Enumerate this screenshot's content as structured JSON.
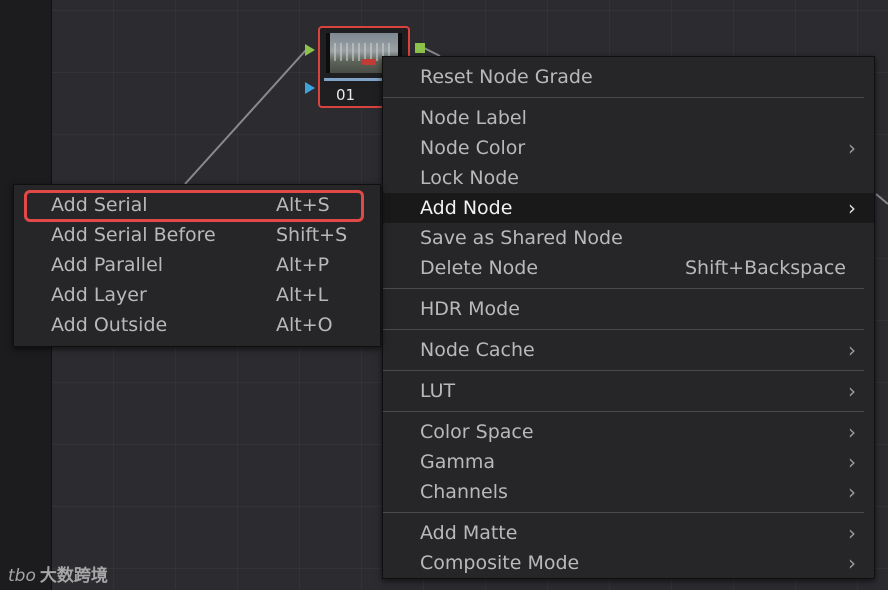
{
  "node": {
    "label": "01"
  },
  "context_menu": {
    "sections": [
      [
        {
          "label": "Reset Node Grade"
        }
      ],
      [
        {
          "label": "Node Label"
        },
        {
          "label": "Node Color",
          "submenu": true
        },
        {
          "label": "Lock Node"
        },
        {
          "label": "Add Node",
          "submenu": true,
          "active": true
        },
        {
          "label": "Save as Shared Node"
        },
        {
          "label": "Delete Node",
          "shortcut": "Shift+Backspace"
        }
      ],
      [
        {
          "label": "HDR Mode"
        }
      ],
      [
        {
          "label": "Node Cache",
          "submenu": true
        }
      ],
      [
        {
          "label": "LUT",
          "submenu": true
        }
      ],
      [
        {
          "label": "Color Space",
          "submenu": true
        },
        {
          "label": "Gamma",
          "submenu": true
        },
        {
          "label": "Channels",
          "submenu": true
        }
      ],
      [
        {
          "label": "Add Matte",
          "submenu": true
        },
        {
          "label": "Composite Mode",
          "submenu": true
        }
      ]
    ]
  },
  "add_node_submenu": {
    "items": [
      {
        "label": "Add Serial",
        "shortcut": "Alt+S",
        "highlighted": true
      },
      {
        "label": "Add Serial Before",
        "shortcut": "Shift+S"
      },
      {
        "label": "Add Parallel",
        "shortcut": "Alt+P"
      },
      {
        "label": "Add Layer",
        "shortcut": "Alt+L"
      },
      {
        "label": "Add Outside",
        "shortcut": "Alt+O"
      }
    ]
  },
  "icons": {
    "chevron": "chevron-right-icon",
    "rgb_input": "green-triangle-port-icon",
    "key_input": "blue-triangle-port-icon"
  },
  "colors": {
    "highlight_outline": "#e04947",
    "node_border": "#d9433e",
    "rgb_port": "#8bc34a",
    "key_port": "#3ea3e0"
  },
  "watermark": {
    "logo": "tbo",
    "text": "大数跨境"
  }
}
